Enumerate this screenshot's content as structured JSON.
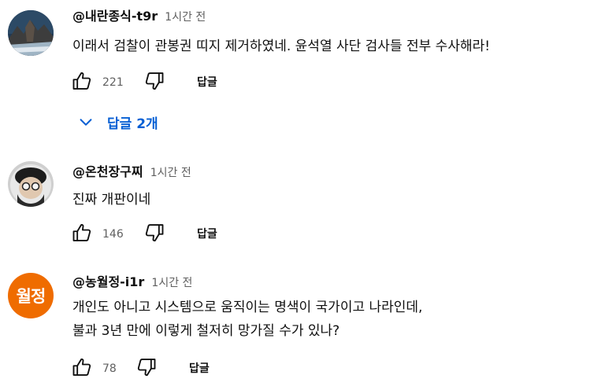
{
  "comments": [
    {
      "author": "@내란종식-t9r",
      "time": "1시간 전",
      "lines": [
        "이래서 검찰이 관봉권 띠지 제거하였네. 윤석열 사단 검사들 전부 수사해라!"
      ],
      "likes": "221",
      "reply_label": "답글",
      "replies_toggle": "답글 2개",
      "avatar": {
        "type": "photo",
        "caption": "Haeundae Busan"
      }
    },
    {
      "author": "@온천장구찌",
      "time": "1시간 전",
      "lines": [
        "진짜 개판이네"
      ],
      "likes": "146",
      "reply_label": "답글",
      "avatar": {
        "type": "photo"
      }
    },
    {
      "author": "@농월정-i1r",
      "time": "1시간 전",
      "lines": [
        "개인도 아니고 시스템으로 움직이는 명색이 국가이고 나라인데,",
        "불과 3년 만에 이렇게 철저히 망가질 수가 있나?"
      ],
      "likes": "78",
      "reply_label": "답글",
      "avatar": {
        "type": "letter",
        "text": "월정",
        "color": "#ef6c00"
      }
    }
  ],
  "colors": {
    "text": "#0f0f0f",
    "secondary": "#606060",
    "link": "#065fd4"
  }
}
